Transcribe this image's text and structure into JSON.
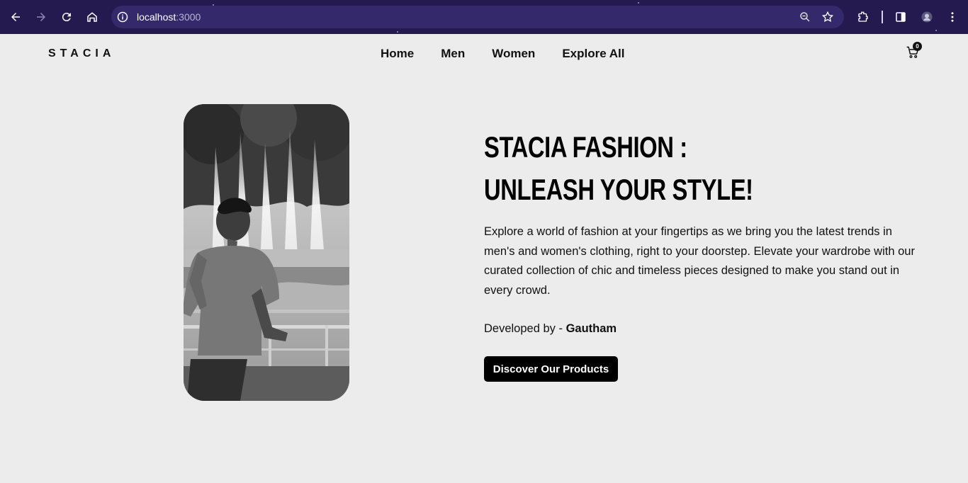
{
  "browser": {
    "url_host": "localhost",
    "url_port": ":3000",
    "icons": [
      "back-arrow-icon",
      "forward-arrow-icon",
      "reload-icon",
      "home-icon",
      "site-info-icon",
      "zoom-icon",
      "bookmark-star-icon",
      "extensions-icon",
      "side-panel-icon",
      "profile-avatar-icon",
      "menu-dots-icon"
    ],
    "theme_color": "#241a4f"
  },
  "header": {
    "logo": "STACIA",
    "nav": [
      "Home",
      "Men",
      "Women",
      "Explore All"
    ],
    "cart_count": "0"
  },
  "hero": {
    "title_line1": "Stacia Fashion :",
    "title_line2": "Unleash Your Style!",
    "description": "Explore a world of fashion at your fingertips as we bring you the latest trends in men's and women's clothing, right to your doorstep. Elevate your wardrobe with our curated collection of chic and timeless pieces designed to make you stand out in every crowd.",
    "developer_prefix": "Developed by - ",
    "developer_name": "Gautham",
    "cta_label": "Discover Our Products"
  },
  "colors": {
    "page_bg": "#ececec",
    "text": "#111111",
    "button_bg": "#000000"
  }
}
